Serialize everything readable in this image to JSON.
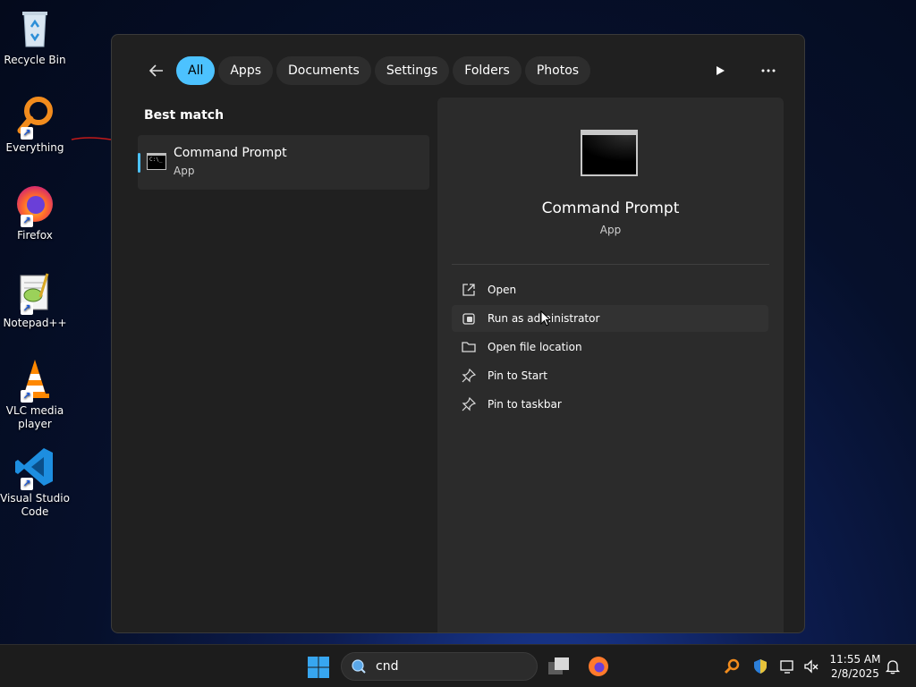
{
  "desktop": {
    "icons": [
      {
        "label": "Recycle Bin"
      },
      {
        "label": "Everything"
      },
      {
        "label": "Firefox"
      },
      {
        "label": "Notepad++"
      },
      {
        "label": "VLC media player"
      },
      {
        "label": "Visual Studio Code"
      }
    ]
  },
  "search_panel": {
    "filters": [
      {
        "label": "All",
        "active": true
      },
      {
        "label": "Apps"
      },
      {
        "label": "Documents"
      },
      {
        "label": "Settings"
      },
      {
        "label": "Folders"
      },
      {
        "label": "Photos"
      }
    ],
    "best_match_label": "Best match",
    "best_match": {
      "title": "Command Prompt",
      "subtitle": "App"
    },
    "detail": {
      "title": "Command Prompt",
      "subtitle": "App",
      "actions": [
        {
          "label": "Open",
          "icon": "open-external-icon"
        },
        {
          "label": "Run as administrator",
          "icon": "shield-admin-icon"
        },
        {
          "label": "Open file location",
          "icon": "folder-icon"
        },
        {
          "label": "Pin to Start",
          "icon": "pin-icon"
        },
        {
          "label": "Pin to taskbar",
          "icon": "pin-icon"
        }
      ]
    }
  },
  "taskbar": {
    "search_value": "cnd",
    "clock_time": "11:55 AM",
    "clock_date": "2/8/2025"
  },
  "colors": {
    "accent": "#4cc2ff",
    "panel_bg": "#202020",
    "detail_bg": "#2b2b2b"
  }
}
